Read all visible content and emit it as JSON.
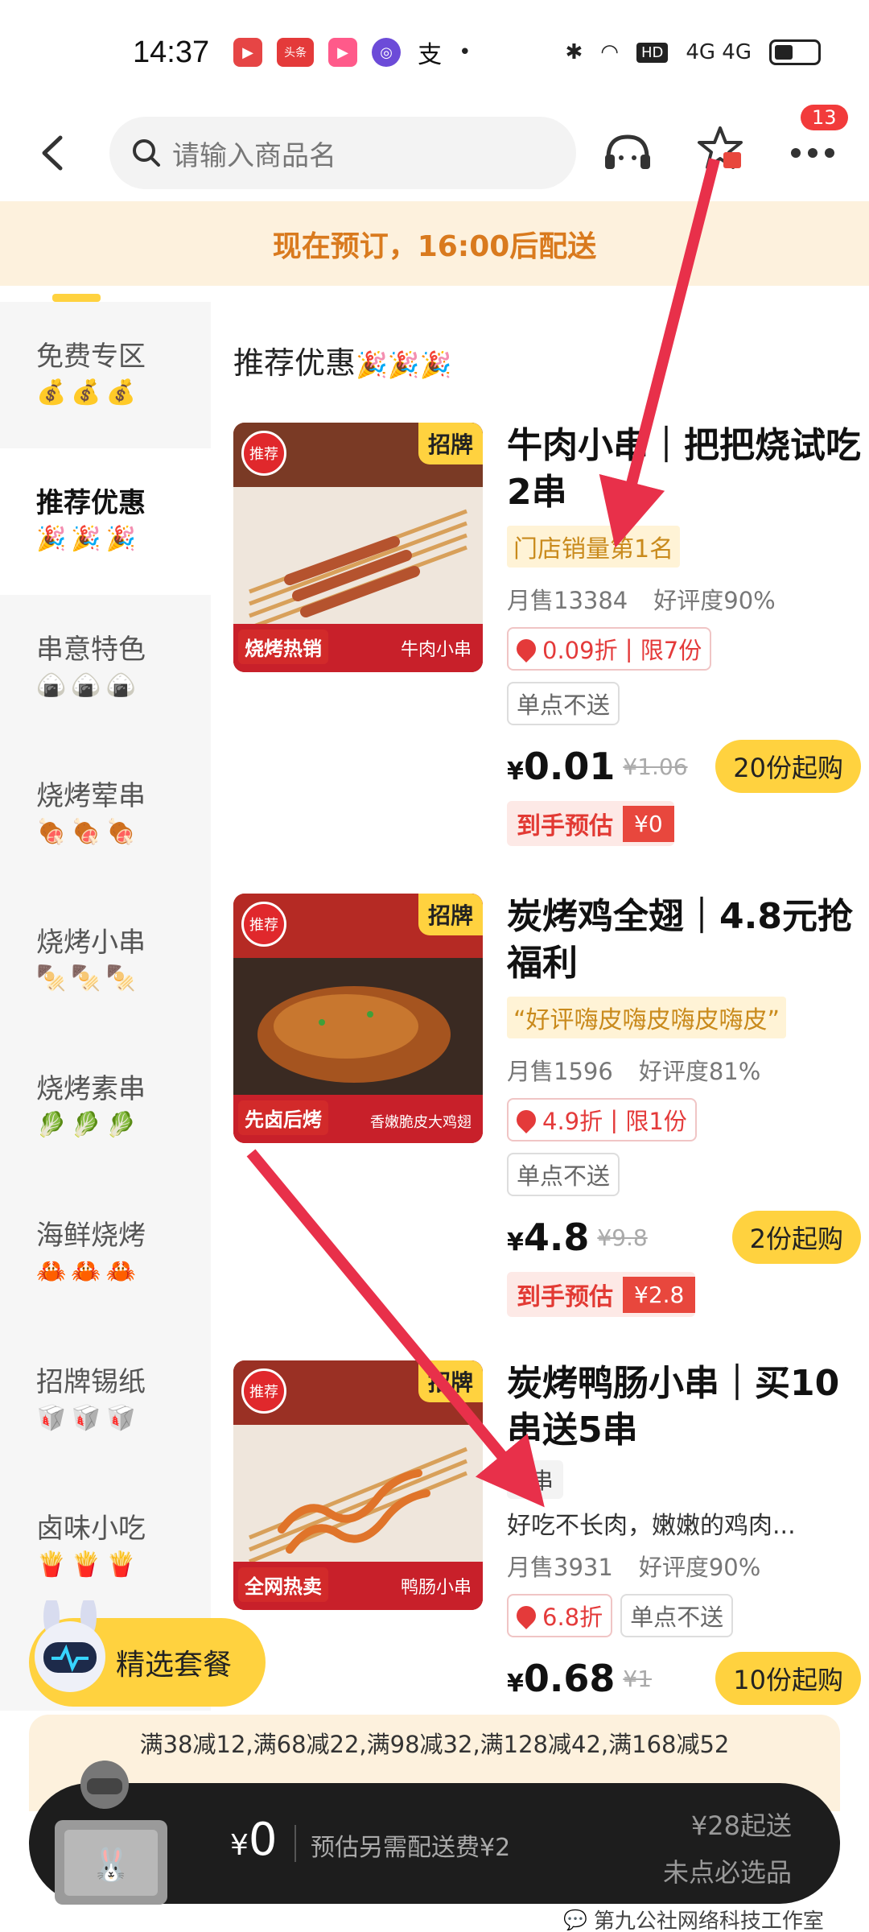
{
  "status_bar": {
    "time": "14:37",
    "apps": [
      {
        "name": "video-app-icon",
        "color": "#e64545",
        "glyph": "▶"
      },
      {
        "name": "toutiao-app-icon",
        "color": "#e43a3a",
        "glyph": "头条"
      },
      {
        "name": "music-app-icon",
        "color": "#ff5a8a",
        "glyph": "▶"
      },
      {
        "name": "circle-app-icon",
        "color": "#6c4bd8",
        "glyph": "◎"
      },
      {
        "name": "alipay-app-icon",
        "color": "#ffffff",
        "glyph": "支"
      }
    ],
    "network": "4G 4G",
    "hd_label": "HD"
  },
  "header": {
    "search_placeholder": "请输入商品名",
    "badge_count": "13"
  },
  "banner": {
    "text": "现在预订，16:00后配送"
  },
  "sidebar": {
    "items": [
      {
        "label": "免费专区",
        "emoji": "💰💰💰"
      },
      {
        "label": "推荐优惠",
        "emoji": "🎉🎉🎉"
      },
      {
        "label": "串意特色",
        "emoji": "🍙🍙🍙"
      },
      {
        "label": "烧烤荤串",
        "emoji": "🍖🍖🍖"
      },
      {
        "label": "烧烤小串",
        "emoji": "🍢🍢🍢"
      },
      {
        "label": "烧烤素串",
        "emoji": "🥬🥬🥬"
      },
      {
        "label": "海鲜烧烤",
        "emoji": "🦀🦀🦀"
      },
      {
        "label": "招牌锡纸",
        "emoji": "🥡🥡🥡"
      },
      {
        "label": "卤味小吃",
        "emoji": "🍟🍟🍟"
      }
    ]
  },
  "section": {
    "title": "推荐优惠",
    "emoji": "🎉🎉🎉"
  },
  "products": [
    {
      "tag": "招牌",
      "stamp": "推荐",
      "thumb_left": "烧烤热销",
      "thumb_right": "牛肉小串",
      "title": "牛肉小串｜把把烧试吃2串",
      "rank": "门店销量第1名",
      "monthly_sales": "月售13384",
      "rating": "好评度90%",
      "discount": "0.09折",
      "limit": "限7份",
      "no_single": "单点不送",
      "price": "0.01",
      "old_price": "¥1.06",
      "buy": "20份起购",
      "estimate_label": "到手预估",
      "estimate_value": "¥0"
    },
    {
      "tag": "招牌",
      "stamp": "推荐",
      "thumb_left": "先卤后烤",
      "thumb_right": "香嫩脆皮大鸡翅",
      "title": "炭烤鸡全翅｜4.8元抢福利",
      "rank": "“好评嗨皮嗨皮嗨皮嗨皮”",
      "monthly_sales": "月售1596",
      "rating": "好评度81%",
      "discount": "4.9折",
      "limit": "限1份",
      "no_single": "单点不送",
      "price": "4.8",
      "old_price": "¥9.8",
      "buy": "2份起购",
      "estimate_label": "到手预估",
      "estimate_value": "¥2.8"
    },
    {
      "tag": "招牌",
      "stamp": "推荐",
      "thumb_left": "全网热卖",
      "thumb_right": "鸭肠小串",
      "title": "炭烤鸭肠小串｜买10串送5串",
      "unit": "1串",
      "desc": "好吃不长肉，嫩嫩的鸡肉...",
      "monthly_sales": "月售3931",
      "rating": "好评度90%",
      "discount": "6.8折",
      "no_single": "单点不送",
      "price": "0.68",
      "old_price": "¥1",
      "buy": "10份起购"
    }
  ],
  "meal_button": {
    "label": "精选套餐"
  },
  "promo": {
    "text": "满38减12,满68减22,满98减32,满128减42,满168减52"
  },
  "cart": {
    "total": "0",
    "fee_note": "预估另需配送费¥2",
    "min_order": "¥28起送",
    "must_item": "未点必选品"
  },
  "watermark": {
    "text": "第九公社网络科技工作室"
  },
  "colors": {
    "accent_yellow": "#ffd23f",
    "banner_bg": "#fdf1dd",
    "banner_text": "#d97a1e",
    "price_red": "#e43a3a",
    "arrow_red": "#e8304a"
  }
}
